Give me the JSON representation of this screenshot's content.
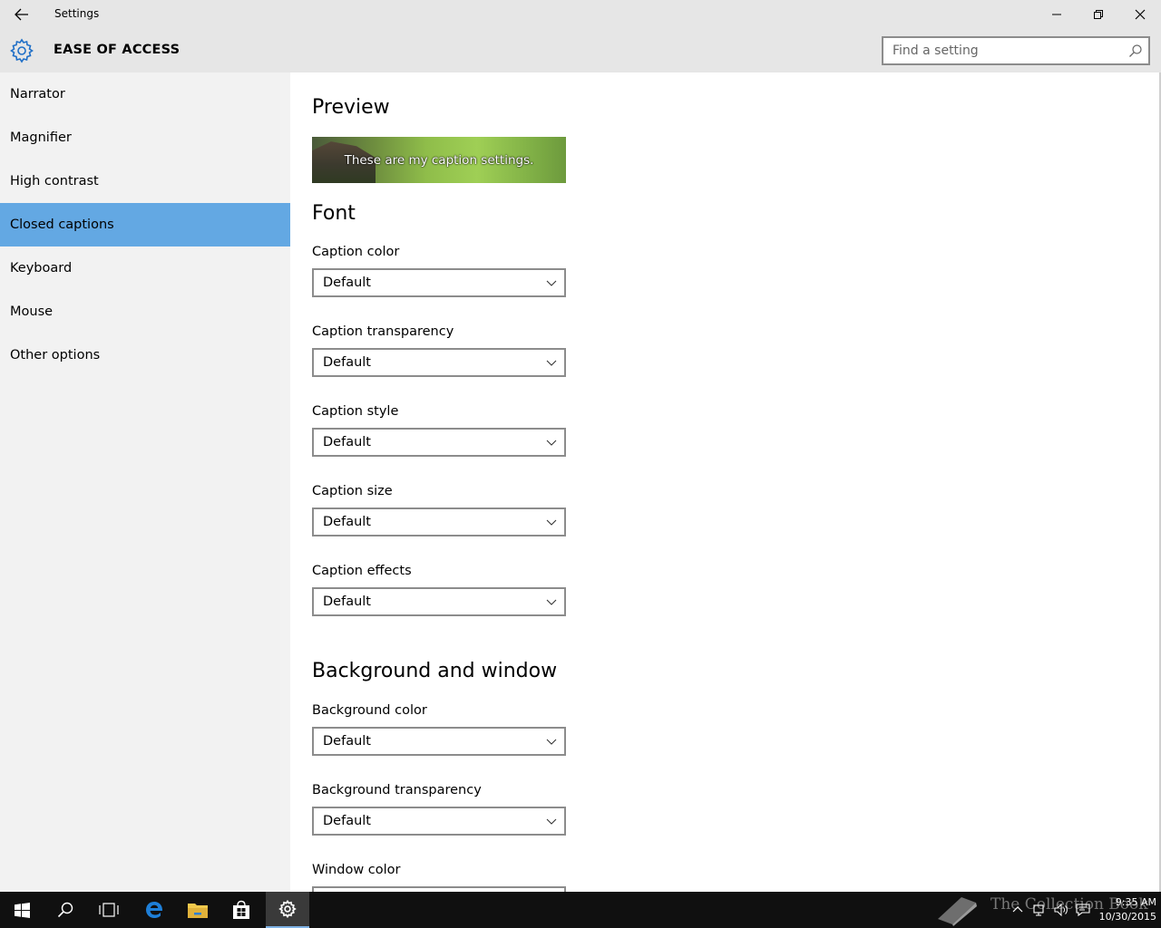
{
  "window": {
    "title": "Settings"
  },
  "header": {
    "section_title": "EASE OF ACCESS",
    "search_placeholder": "Find a setting"
  },
  "sidebar": {
    "items": [
      {
        "label": "Narrator"
      },
      {
        "label": "Magnifier"
      },
      {
        "label": "High contrast"
      },
      {
        "label": "Closed captions",
        "selected": true
      },
      {
        "label": "Keyboard"
      },
      {
        "label": "Mouse"
      },
      {
        "label": "Other options"
      }
    ]
  },
  "main": {
    "preview_heading": "Preview",
    "preview_caption": "These are my caption settings.",
    "font_heading": "Font",
    "font_fields": [
      {
        "label": "Caption color",
        "value": "Default"
      },
      {
        "label": "Caption transparency",
        "value": "Default"
      },
      {
        "label": "Caption style",
        "value": "Default"
      },
      {
        "label": "Caption size",
        "value": "Default"
      },
      {
        "label": "Caption effects",
        "value": "Default"
      }
    ],
    "background_heading": "Background and window",
    "background_fields": [
      {
        "label": "Background color",
        "value": "Default"
      },
      {
        "label": "Background transparency",
        "value": "Default"
      },
      {
        "label": "Window color",
        "value": ""
      }
    ]
  },
  "taskbar": {
    "watermark": "The Collection Book",
    "time": "9:35 AM",
    "date": "10/30/2015"
  },
  "colors": {
    "accent": "#63a8e3",
    "chrome": "#e6e6e6",
    "sidebar": "#f2f2f2",
    "taskbar": "#101010"
  },
  "icons": [
    "back-arrow-icon",
    "minimize-icon",
    "restore-icon",
    "close-icon",
    "gear-icon",
    "search-icon",
    "chevron-down-icon",
    "windows-start-icon",
    "task-view-icon",
    "edge-icon",
    "file-explorer-icon",
    "store-icon",
    "settings-icon",
    "network-icon",
    "volume-icon",
    "action-center-icon"
  ]
}
